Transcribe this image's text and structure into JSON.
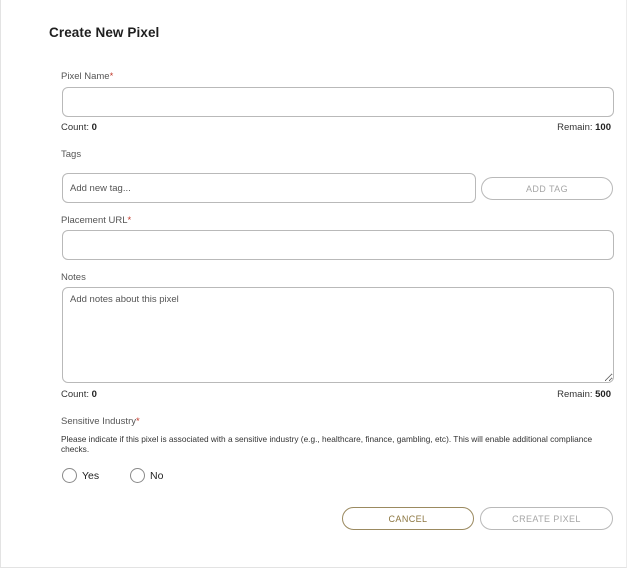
{
  "dialog": {
    "title": "Create New Pixel"
  },
  "pixel_name": {
    "label": "Pixel Name",
    "required_mark": "*",
    "value": "",
    "placeholder": "",
    "count_label": "Count:",
    "count_value": "0",
    "remain_label": "Remain:",
    "remain_value": "100"
  },
  "tags": {
    "label": "Tags",
    "placeholder": "Add new tag...",
    "add_button_label": "ADD TAG"
  },
  "placement_url": {
    "label": "Placement URL",
    "required_mark": "*",
    "value": ""
  },
  "notes": {
    "label": "Notes",
    "placeholder": "Add notes about this pixel",
    "count_label": "Count:",
    "count_value": "0",
    "remain_label": "Remain:",
    "remain_value": "500"
  },
  "sensitive_industry": {
    "label": "Sensitive Industry",
    "required_mark": "*",
    "helper_text": "Please indicate if this pixel is associated with a sensitive industry (e.g., healthcare, finance, gambling, etc). This will enable additional compliance checks.",
    "options": [
      {
        "label": "Yes",
        "selected": false
      },
      {
        "label": "No",
        "selected": false
      }
    ]
  },
  "actions": {
    "cancel_label": "CANCEL",
    "create_label": "CREATE PIXEL"
  },
  "colors": {
    "accent_border": "#9b8a60",
    "accent_text": "#8c7640",
    "disabled_text": "#a6a6a6",
    "required": "#c0392b"
  }
}
